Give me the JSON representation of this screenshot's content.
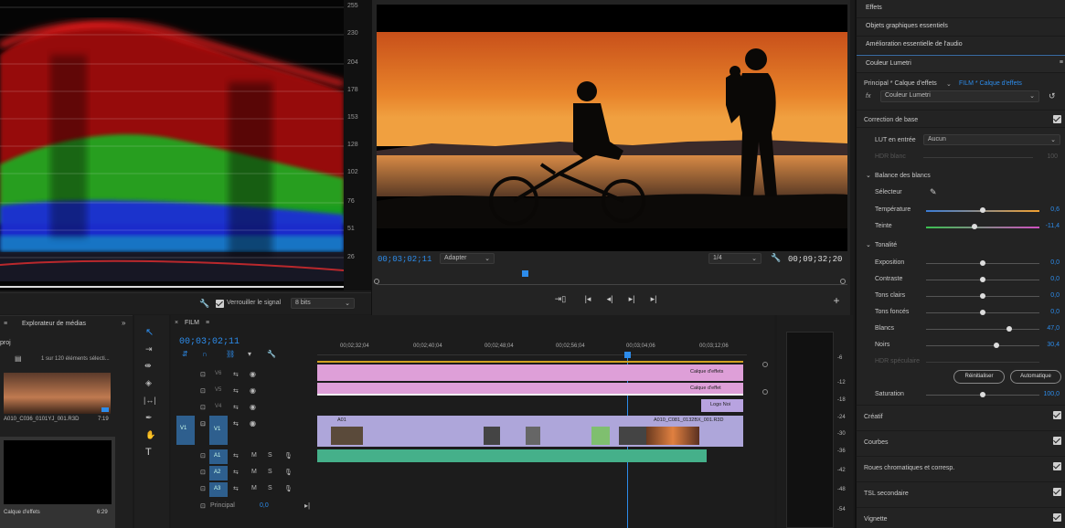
{
  "scope": {
    "scale": [
      "255",
      "230",
      "204",
      "178",
      "153",
      "128",
      "102",
      "76",
      "51",
      "26"
    ],
    "lock_signal_label": "Verrouiller le signal",
    "bits_value": "8 bits"
  },
  "program": {
    "timecode": "00;03;02;11",
    "fit_value": "Adapter",
    "resolution_value": "1/4",
    "duration": "00;09;32;20"
  },
  "right_panel": {
    "top_items": [
      "Effets",
      "Objets graphiques essentiels",
      "Amélioration essentielle de l'audio"
    ],
    "panel_title": "Couleur Lumetri",
    "breadcrumb_left": "Principal * Calque d'effets",
    "breadcrumb_right": "FILM * Calque d'effets",
    "fx_label": "fx",
    "effect_name": "Couleur Lumetri",
    "basic_correction": "Correction de base",
    "lut_label": "LUT en entrée",
    "lut_value": "Aucun",
    "hdr_white_label": "HDR blanc",
    "hdr_white_value": "100",
    "white_balance": "Balance des blancs",
    "selector_label": "Sélecteur",
    "tone": "Tonalité",
    "sliders": [
      {
        "label": "Température",
        "value": "0,6",
        "pos": 0.5
      },
      {
        "label": "Teinte",
        "value": "-11,4",
        "pos": 0.43
      },
      {
        "label": "Exposition",
        "value": "0,0",
        "pos": 0.5
      },
      {
        "label": "Contraste",
        "value": "0,0",
        "pos": 0.5
      },
      {
        "label": "Tons clairs",
        "value": "0,0",
        "pos": 0.5
      },
      {
        "label": "Tons foncés",
        "value": "0,0",
        "pos": 0.5
      },
      {
        "label": "Blancs",
        "value": "47,0",
        "pos": 0.73
      },
      {
        "label": "Noirs",
        "value": "30,4",
        "pos": 0.62
      },
      {
        "label": "HDR spéculaire",
        "value": "",
        "pos": 0.5
      }
    ],
    "reset_button": "Réinitialiser",
    "auto_button": "Automatique",
    "saturation_label": "Saturation",
    "saturation_value": "100,0",
    "sections": [
      "Créatif",
      "Courbes",
      "Roues chromatiques et corresp.",
      "TSL secondaire",
      "Vignette"
    ]
  },
  "media_browser": {
    "tab_label": "Explorateur de médias",
    "proj_label": "proj",
    "count_text": "1 sur 120 éléments sélecti...",
    "clip1_name": "A010_C036_0101YJ_001.R3D",
    "clip1_duration": "7:19",
    "clip2_name": "Calque d'effets",
    "clip2_duration": "6:29"
  },
  "timeline": {
    "sequence_name": "FILM",
    "timecode": "00;03;02;11",
    "ruler": [
      "00;02;32;04",
      "00;02;40;04",
      "00;02;48;04",
      "00;02;56;04",
      "00;03;04;06",
      "00;03;12;06"
    ],
    "video_tracks": [
      "V6",
      "V5",
      "V4",
      "V3"
    ],
    "v1_source": "V1",
    "v1_track": "V1",
    "audio_tracks": [
      "A1",
      "A2",
      "A3"
    ],
    "master_label": "Principal",
    "master_value": "0,0",
    "clip_effect1": "Calque d'effets",
    "clip_effect2": "Calque d'effet",
    "clip_logo": "Logo Noi",
    "clip_a01": "A01",
    "clip_main": "A010_C081_0132BX_001.R3D"
  },
  "meters": {
    "scale": [
      "-6",
      "-12",
      "-18",
      "-24",
      "-30",
      "-36",
      "-42",
      "-48",
      "-54"
    ]
  }
}
